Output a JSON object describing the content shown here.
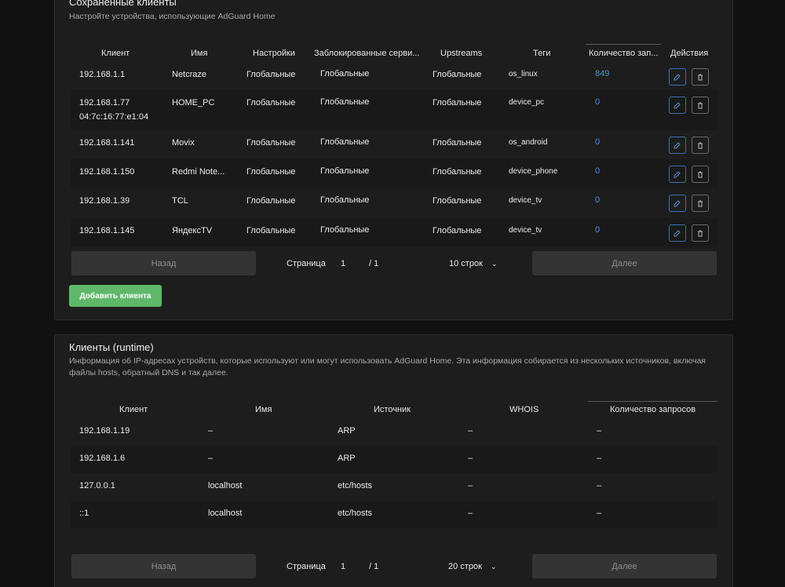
{
  "saved": {
    "title": "Сохраненные клиенты",
    "subtitle": "Настройте устройства, использующие AdGuard Home",
    "columns": [
      "Клиент",
      "Имя",
      "Настройки",
      "Заблокированные серви...",
      "Upstreams",
      "Теги",
      "Количество зап...",
      "Действия"
    ],
    "rows": [
      {
        "client": "192.168.1.1",
        "client2": "",
        "name": "Netcraze",
        "settings": "Глобальные",
        "blocked": "Глобальные",
        "upstreams": "Глобальные",
        "tags": "os_linux",
        "count": "849"
      },
      {
        "client": "192.168.1.77",
        "client2": "04:7c:16:77:e1:04",
        "name": "HOME_PC",
        "settings": "Глобальные",
        "blocked": "Глобальные",
        "upstreams": "Глобальные",
        "tags": "device_pc",
        "count": "0"
      },
      {
        "client": "192.168.1.141",
        "client2": "",
        "name": "Movix",
        "settings": "Глобальные",
        "blocked": "Глобальные",
        "upstreams": "Глобальные",
        "tags": "os_android",
        "count": "0"
      },
      {
        "client": "192.168.1.150",
        "client2": "",
        "name": "Redmi Note...",
        "settings": "Глобальные",
        "blocked": "Глобальные",
        "upstreams": "Глобальные",
        "tags": "device_phone",
        "count": "0"
      },
      {
        "client": "192.168.1.39",
        "client2": "",
        "name": "TCL",
        "settings": "Глобальные",
        "blocked": "Глобальные",
        "upstreams": "Глобальные",
        "tags": "device_tv",
        "count": "0"
      },
      {
        "client": "192.168.1.145",
        "client2": "",
        "name": "ЯндексTV",
        "settings": "Глобальные",
        "blocked": "Глобальные",
        "upstreams": "Глобальные",
        "tags": "device_tv",
        "count": "0"
      }
    ],
    "pager": {
      "prev": "Назад",
      "page_label": "Страница",
      "page": "1",
      "total": "/ 1",
      "rows_select": "10 строк",
      "next": "Далее"
    },
    "add_button": "Добавить клиента"
  },
  "runtime": {
    "title": "Клиенты (runtime)",
    "subtitle": "Информация об IP-адресах устройств, которые используют или могут использовать AdGuard Home. Эта информация собирается из нескольких источников, включая файлы hosts, обратный DNS и так далее.",
    "columns": [
      "Клиент",
      "Имя",
      "Источник",
      "WHOIS",
      "Количество запросов"
    ],
    "rows": [
      {
        "client": "192.168.1.19",
        "name": "–",
        "source": "ARP",
        "whois": "–",
        "count": "–"
      },
      {
        "client": "192.168.1.6",
        "name": "–",
        "source": "ARP",
        "whois": "–",
        "count": "–"
      },
      {
        "client": "127.0.0.1",
        "name": "localhost",
        "source": "etc/hosts",
        "whois": "–",
        "count": "–"
      },
      {
        "client": "::1",
        "name": "localhost",
        "source": "etc/hosts",
        "whois": "–",
        "count": "–"
      }
    ],
    "pager": {
      "prev": "Назад",
      "page_label": "Страница",
      "page": "1",
      "total": "/ 1",
      "rows_select": "20 строк",
      "next": "Далее"
    }
  },
  "icons": {
    "edit": "edit-icon",
    "delete": "trash-icon",
    "select_arrow": "chevron-down-icon"
  },
  "colors": {
    "background": "#121212",
    "card": "#1d1d1d",
    "link": "#4d8fe0",
    "add_button": "#5fb86a",
    "pager_button": "#343434"
  }
}
